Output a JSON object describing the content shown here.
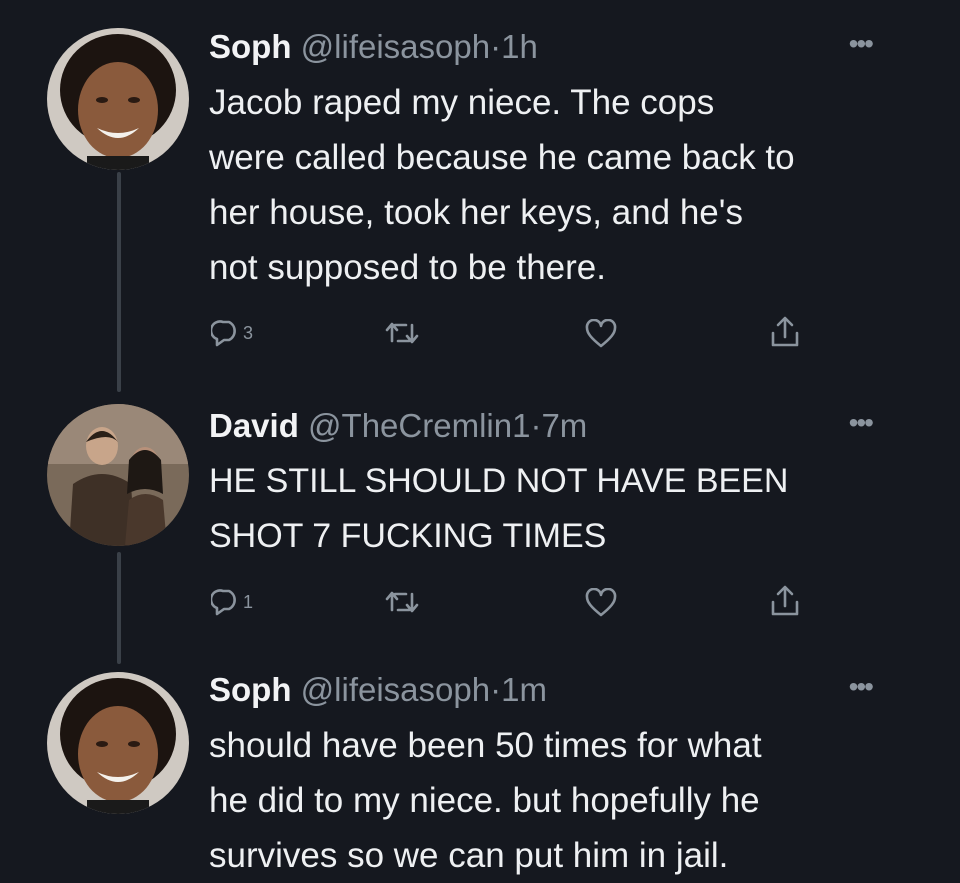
{
  "tweets": [
    {
      "name": "Soph",
      "handle": "@lifeisasoph",
      "separator": "·",
      "time": "1h",
      "more": "•••",
      "lines": [
        "Jacob raped my niece. The cops",
        "were called because he came back to",
        "her house, took her keys, and he's",
        "not supposed to be there."
      ],
      "reply_count": "3",
      "avatar": "woman-smiling-avatar"
    },
    {
      "name": "David",
      "handle": "@TheCremlin1",
      "separator": "·",
      "time": "7m",
      "more": "•••",
      "lines": [
        "HE STILL SHOULD NOT HAVE BEEN",
        "SHOT 7 FUCKING TIMES"
      ],
      "reply_count": "1",
      "avatar": "couple-photo-avatar"
    },
    {
      "name": "Soph",
      "handle": "@lifeisasoph",
      "separator": "·",
      "time": "1m",
      "more": "•••",
      "lines": [
        "should have been 50 times for what",
        "he did to my niece. but hopefully he",
        "survives so we can put him in jail."
      ],
      "avatar": "woman-smiling-avatar"
    }
  ],
  "icons": {
    "reply": "reply-icon",
    "retweet": "retweet-icon",
    "like": "heart-icon",
    "share": "share-icon"
  },
  "colors": {
    "background": "#15181f",
    "text": "#eef0f2",
    "secondary": "#8b949e",
    "thread_line": "#3a4048"
  }
}
